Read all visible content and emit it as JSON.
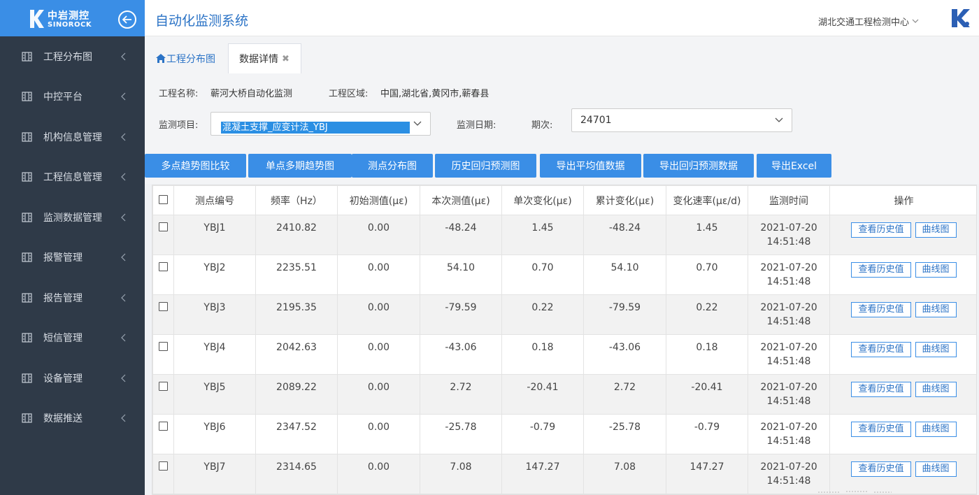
{
  "brand": {
    "cn": "中岩测控",
    "en": "SINOROCK"
  },
  "sidebar": {
    "items": [
      {
        "label": "工程分布图",
        "icon": "grid-icon"
      },
      {
        "label": "中控平台",
        "icon": "grid-icon"
      },
      {
        "label": "机构信息管理",
        "icon": "grid-icon"
      },
      {
        "label": "工程信息管理",
        "icon": "grid-icon"
      },
      {
        "label": "监测数据管理",
        "icon": "grid-icon"
      },
      {
        "label": "报警管理",
        "icon": "grid-icon"
      },
      {
        "label": "报告管理",
        "icon": "grid-icon"
      },
      {
        "label": "短信管理",
        "icon": "grid-icon"
      },
      {
        "label": "设备管理",
        "icon": "grid-icon"
      },
      {
        "label": "数据推送",
        "icon": "grid-icon"
      }
    ]
  },
  "header": {
    "title": "自动化监测系统",
    "org": "湖北交通工程检测中心"
  },
  "tabs": {
    "home": "工程分布图",
    "active": "数据详情"
  },
  "filters": {
    "project_label": "工程名称:",
    "project_value": "蕲河大桥自动化监测",
    "region_label": "工程区域:",
    "region_value": "中国,湖北省,黄冈市,蕲春县",
    "item_label": "监测项目:",
    "item_value": "混凝土支撑_应变计法_YBJ",
    "date_label": "监测日期:",
    "period_label": "期次:",
    "period_value": "24701"
  },
  "actions": [
    "多点趋势图比较",
    "单点多期趋势图",
    "测点分布图",
    "历史回归预测图",
    "导出平均值数据",
    "导出回归预测数据",
    "导出Excel"
  ],
  "table": {
    "headers": [
      "测点编号",
      "频率（Hz）",
      "初始测值(με)",
      "本次测值(με)",
      "单次变化(με)",
      "累计变化(με)",
      "变化速率(με/d)",
      "监测时间",
      "操作"
    ],
    "op_history": "查看历史值",
    "op_curve": "曲线图",
    "rows": [
      {
        "id": "YBJ1",
        "freq": "2410.82",
        "init": "0.00",
        "cur": "-48.24",
        "single": "1.45",
        "total": "-48.24",
        "rate": "1.45",
        "date": "2021-07-20",
        "time": "14:51:48"
      },
      {
        "id": "YBJ2",
        "freq": "2235.51",
        "init": "0.00",
        "cur": "54.10",
        "single": "0.70",
        "total": "54.10",
        "rate": "0.70",
        "date": "2021-07-20",
        "time": "14:51:48"
      },
      {
        "id": "YBJ3",
        "freq": "2195.35",
        "init": "0.00",
        "cur": "-79.59",
        "single": "0.22",
        "total": "-79.59",
        "rate": "0.22",
        "date": "2021-07-20",
        "time": "14:51:48"
      },
      {
        "id": "YBJ4",
        "freq": "2042.63",
        "init": "0.00",
        "cur": "-43.06",
        "single": "0.18",
        "total": "-43.06",
        "rate": "0.18",
        "date": "2021-07-20",
        "time": "14:51:48"
      },
      {
        "id": "YBJ5",
        "freq": "2089.22",
        "init": "0.00",
        "cur": "2.72",
        "single": "-20.41",
        "total": "2.72",
        "rate": "-20.41",
        "date": "2021-07-20",
        "time": "14:51:48"
      },
      {
        "id": "YBJ6",
        "freq": "2347.52",
        "init": "0.00",
        "cur": "-25.78",
        "single": "-0.79",
        "total": "-25.78",
        "rate": "-0.79",
        "date": "2021-07-20",
        "time": "14:51:48"
      },
      {
        "id": "YBJ7",
        "freq": "2314.65",
        "init": "0.00",
        "cur": "7.08",
        "single": "147.27",
        "total": "7.08",
        "rate": "147.27",
        "date": "2021-07-20",
        "time": "14:51:48"
      }
    ]
  },
  "colors": {
    "accent": "#3a8ee6",
    "sidebar": "#2f3a48",
    "title": "#2b73c6"
  }
}
